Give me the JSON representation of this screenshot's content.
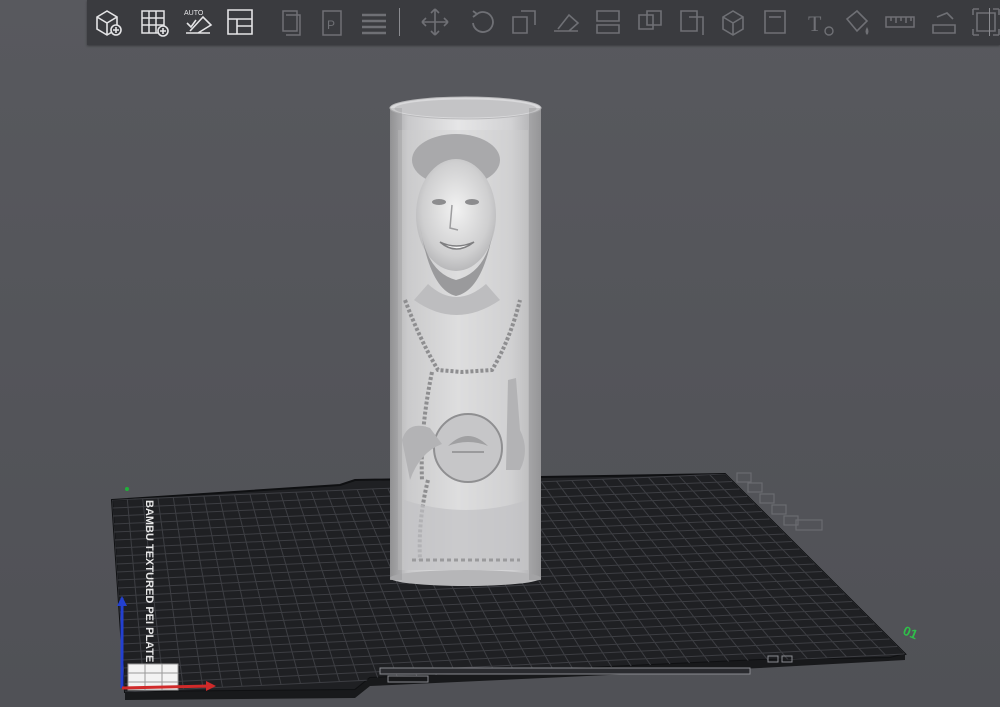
{
  "toolbar": {
    "buttons": [
      {
        "name": "add-object-button",
        "icon": "cube-plus-icon",
        "enabled": true
      },
      {
        "name": "add-plate-button",
        "icon": "grid-plus-icon",
        "enabled": true
      },
      {
        "name": "auto-orient-button",
        "icon": "auto-orient-icon",
        "label": "AUTO",
        "enabled": true
      },
      {
        "name": "arrange-button",
        "icon": "arrange-layout-icon",
        "enabled": true
      },
      {
        "name": "copy-button",
        "icon": "copy-icon",
        "enabled": false
      },
      {
        "name": "paste-button",
        "icon": "paste-icon",
        "label": "P",
        "enabled": false
      },
      {
        "name": "layers-button",
        "icon": "layers-icon",
        "enabled": false
      },
      {
        "name": "move-button",
        "icon": "move-arrows-icon",
        "enabled": false
      },
      {
        "name": "rotate-button",
        "icon": "rotate-icon",
        "enabled": false
      },
      {
        "name": "scale-button",
        "icon": "scale-icon",
        "enabled": false
      },
      {
        "name": "lay-on-face-button",
        "icon": "lay-on-face-icon",
        "enabled": false
      },
      {
        "name": "cut-button",
        "icon": "cut-icon",
        "enabled": false
      },
      {
        "name": "split-button",
        "icon": "split-icon",
        "enabled": false
      },
      {
        "name": "boolean-button",
        "icon": "boolean-icon",
        "enabled": false
      },
      {
        "name": "support-paint-button",
        "icon": "support-paint-icon",
        "enabled": false
      },
      {
        "name": "seam-paint-button",
        "icon": "seam-paint-icon",
        "enabled": false
      },
      {
        "name": "text-button",
        "icon": "text-tool-icon",
        "label": "T",
        "enabled": false
      },
      {
        "name": "color-paint-button",
        "icon": "paint-bucket-icon",
        "enabled": false
      },
      {
        "name": "measure-button",
        "icon": "ruler-icon",
        "enabled": false
      },
      {
        "name": "assembly-button",
        "icon": "assembly-icon",
        "enabled": false
      },
      {
        "name": "fit-view-button",
        "icon": "fit-view-icon",
        "enabled": false
      }
    ]
  },
  "plate": {
    "side_label": "BAMBU TEXTURED PEI PLATE",
    "plate_number": "01",
    "colors": {
      "plate": "#1f2023",
      "grid": "#3c3d42",
      "x_axis": "#d02a2a",
      "y_axis": "#2340d0",
      "z_axis": "#21b03a",
      "model": "#d8d8d8",
      "background": "#55565b",
      "toolbar": "#3a3b3f"
    }
  },
  "model": {
    "shape": "cylinder-lithophane",
    "icon": "lithophane-cylinder-icon"
  }
}
